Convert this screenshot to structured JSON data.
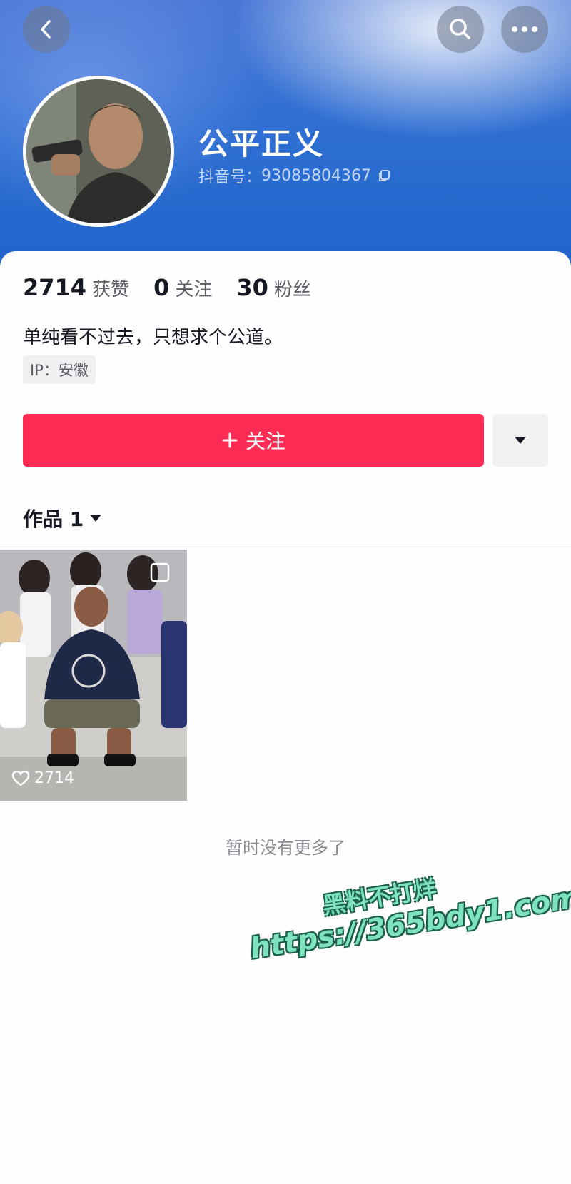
{
  "profile": {
    "nickname": "公平正义",
    "id_label": "抖音号：",
    "id_value": "93085804367",
    "bio": "单纯看不过去，只想求个公道。",
    "ip": "IP：安徽"
  },
  "stats": [
    {
      "value": "2714",
      "label": "获赞"
    },
    {
      "value": "0",
      "label": "关注"
    },
    {
      "value": "30",
      "label": "粉丝"
    }
  ],
  "actions": {
    "follow_label": "关注"
  },
  "works": {
    "tab_label": "作品 1",
    "items": [
      {
        "likes": "2714"
      }
    ],
    "end_text": "暂时没有更多了"
  },
  "watermark": {
    "line1": "黑料不打烊",
    "line2": "https://365bdy1.com"
  },
  "colors": {
    "accent": "#fe2c55",
    "header": "#2f6fd3"
  }
}
